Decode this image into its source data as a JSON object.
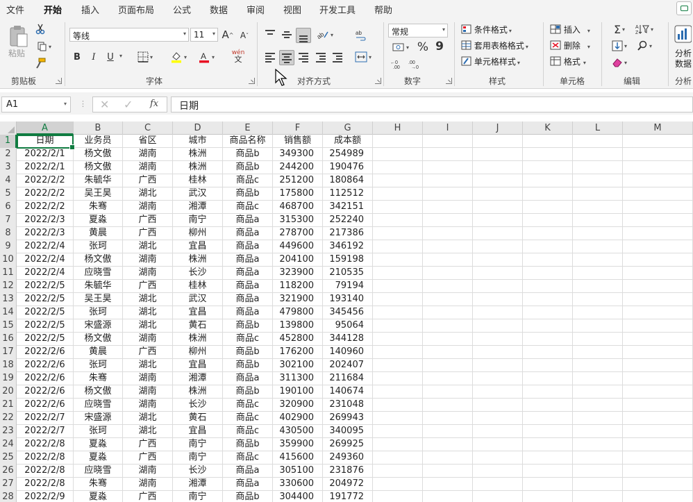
{
  "tabs": [
    "文件",
    "开始",
    "插入",
    "页面布局",
    "公式",
    "数据",
    "审阅",
    "视图",
    "开发工具",
    "帮助"
  ],
  "active_tab": "开始",
  "ribbon": {
    "clipboard": {
      "paste": "粘贴",
      "label": "剪贴板"
    },
    "font": {
      "font_name": "等线",
      "font_size": "11",
      "label": "字体",
      "grow": "A",
      "shrink": "A",
      "bold": "B",
      "italic": "I",
      "underline": "U",
      "wen": "wén",
      "wen2": "文"
    },
    "alignment": {
      "label": "对齐方式"
    },
    "number": {
      "format": "常规",
      "label": "数字",
      "percent": "%",
      "comma": "9"
    },
    "styles": {
      "conditional": "条件格式",
      "table": "套用表格格式",
      "cell": "单元格样式",
      "label": "样式"
    },
    "cells": {
      "insert": "插入",
      "delete": "删除",
      "format": "格式",
      "label": "单元格"
    },
    "editing": {
      "label": "编辑"
    },
    "analysis": {
      "line1": "分析",
      "line2": "数据",
      "label": "分析"
    }
  },
  "formula_bar": {
    "name_box": "A1",
    "fx": "fx",
    "content": "日期"
  },
  "columns": [
    "A",
    "B",
    "C",
    "D",
    "E",
    "F",
    "G",
    "H",
    "I",
    "J",
    "K",
    "L",
    "M"
  ],
  "headers": [
    "日期",
    "业务员",
    "省区",
    "城市",
    "商品名称",
    "销售额",
    "成本额"
  ],
  "rows": [
    [
      "2022/2/1",
      "杨文傲",
      "湖南",
      "株洲",
      "商品b",
      "349300",
      "254989"
    ],
    [
      "2022/2/1",
      "杨文傲",
      "湖南",
      "株洲",
      "商品b",
      "244200",
      "190476"
    ],
    [
      "2022/2/2",
      "朱毓华",
      "广西",
      "桂林",
      "商品c",
      "251200",
      "180864"
    ],
    [
      "2022/2/2",
      "吴王昊",
      "湖北",
      "武汉",
      "商品b",
      "175800",
      "112512"
    ],
    [
      "2022/2/2",
      "朱骞",
      "湖南",
      "湘潭",
      "商品c",
      "468700",
      "342151"
    ],
    [
      "2022/2/3",
      "夏淼",
      "广西",
      "南宁",
      "商品a",
      "315300",
      "252240"
    ],
    [
      "2022/2/3",
      "黄晨",
      "广西",
      "柳州",
      "商品a",
      "278700",
      "217386"
    ],
    [
      "2022/2/4",
      "张珂",
      "湖北",
      "宜昌",
      "商品a",
      "449600",
      "346192"
    ],
    [
      "2022/2/4",
      "杨文傲",
      "湖南",
      "株洲",
      "商品a",
      "204100",
      "159198"
    ],
    [
      "2022/2/4",
      "应晓雪",
      "湖南",
      "长沙",
      "商品a",
      "323900",
      "210535"
    ],
    [
      "2022/2/5",
      "朱毓华",
      "广西",
      "桂林",
      "商品a",
      "118200",
      "79194"
    ],
    [
      "2022/2/5",
      "吴王昊",
      "湖北",
      "武汉",
      "商品a",
      "321900",
      "193140"
    ],
    [
      "2022/2/5",
      "张珂",
      "湖北",
      "宜昌",
      "商品a",
      "479800",
      "345456"
    ],
    [
      "2022/2/5",
      "宋盛源",
      "湖北",
      "黄石",
      "商品b",
      "139800",
      "95064"
    ],
    [
      "2022/2/5",
      "杨文傲",
      "湖南",
      "株洲",
      "商品c",
      "452800",
      "344128"
    ],
    [
      "2022/2/6",
      "黄晨",
      "广西",
      "柳州",
      "商品b",
      "176200",
      "140960"
    ],
    [
      "2022/2/6",
      "张珂",
      "湖北",
      "宜昌",
      "商品b",
      "302100",
      "202407"
    ],
    [
      "2022/2/6",
      "朱骞",
      "湖南",
      "湘潭",
      "商品a",
      "311300",
      "211684"
    ],
    [
      "2022/2/6",
      "杨文傲",
      "湖南",
      "株洲",
      "商品b",
      "190100",
      "140674"
    ],
    [
      "2022/2/6",
      "应晓雪",
      "湖南",
      "长沙",
      "商品c",
      "320900",
      "231048"
    ],
    [
      "2022/2/7",
      "宋盛源",
      "湖北",
      "黄石",
      "商品c",
      "402900",
      "269943"
    ],
    [
      "2022/2/7",
      "张珂",
      "湖北",
      "宜昌",
      "商品c",
      "430500",
      "340095"
    ],
    [
      "2022/2/8",
      "夏淼",
      "广西",
      "南宁",
      "商品b",
      "359900",
      "269925"
    ],
    [
      "2022/2/8",
      "夏淼",
      "广西",
      "南宁",
      "商品c",
      "415600",
      "249360"
    ],
    [
      "2022/2/8",
      "应晓雪",
      "湖南",
      "长沙",
      "商品a",
      "305100",
      "231876"
    ],
    [
      "2022/2/8",
      "朱骞",
      "湖南",
      "湘潭",
      "商品a",
      "330600",
      "204972"
    ],
    [
      "2022/2/9",
      "夏淼",
      "广西",
      "南宁",
      "商品b",
      "304400",
      "191772"
    ]
  ],
  "colors": {
    "accent": "#107c41",
    "font_color": "#e81123",
    "highlight": "#ffff00"
  }
}
